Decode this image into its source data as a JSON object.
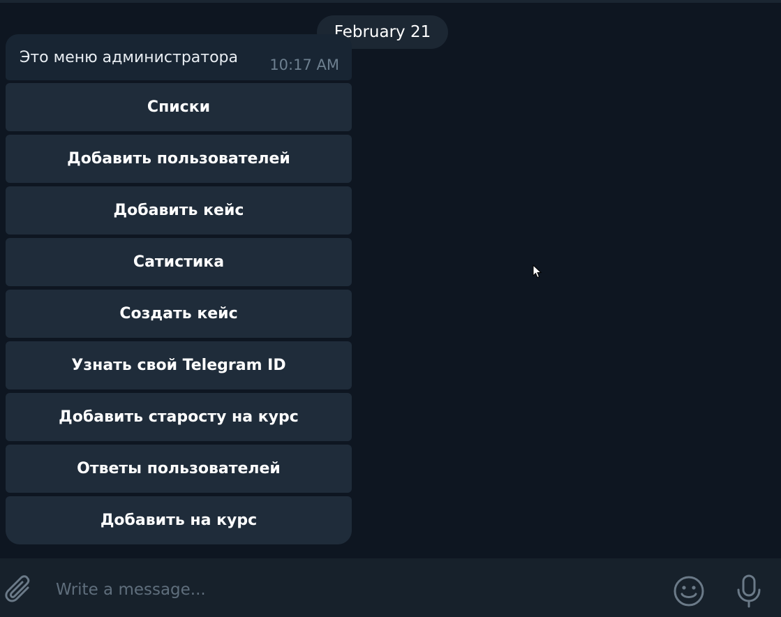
{
  "chat": {
    "date_separator": "February 21",
    "message": {
      "text": "Это меню администратора",
      "time": "10:17 AM"
    },
    "keyboard_buttons": [
      {
        "label": "Списки"
      },
      {
        "label": "Добавить пользователей"
      },
      {
        "label": "Добавить кейс"
      },
      {
        "label": "Сатистика"
      },
      {
        "label": "Создать кейс"
      },
      {
        "label": "Узнать свой Telegram ID"
      },
      {
        "label": "Добавить старосту на курс"
      },
      {
        "label": "Ответы пользователей"
      },
      {
        "label": "Добавить на курс"
      }
    ]
  },
  "composer": {
    "placeholder": "Write a message...",
    "attach_icon": "paperclip-icon",
    "emoji_icon": "smile-icon",
    "mic_icon": "microphone-icon"
  },
  "colors": {
    "background": "#0e1621",
    "bubble": "#182533",
    "button": "#1f2c3a",
    "composer": "#17212b",
    "muted_text": "#6d7f8f"
  }
}
